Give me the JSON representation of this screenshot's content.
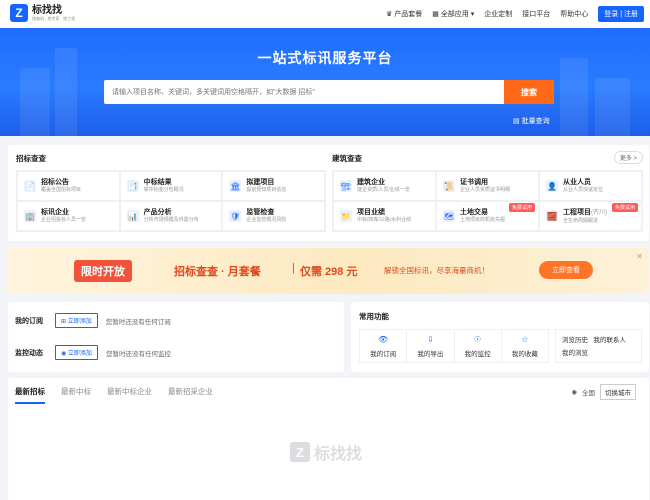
{
  "header": {
    "logo_letter": "Z",
    "logo_name": "标找找",
    "logo_sub": "找商机 · 找专家 · 找工程",
    "nav": {
      "product": "产品套餐",
      "all_apps": "全部应用",
      "enterprise": "企业定制",
      "api": "接口平台",
      "help": "帮助中心",
      "login": "登录 | 注册"
    }
  },
  "hero": {
    "title": "一站式标讯服务平台",
    "search_placeholder": "请输入项目名称、关键词，多关键词用空格隔开，如\"大数据 招标\"",
    "search_button": "搜索",
    "batch_query": "批量查询"
  },
  "bidding": {
    "title": "招标查查",
    "items": [
      {
        "icon": "📄",
        "title": "招标公告",
        "desc": "覆盖全国招标项目"
      },
      {
        "icon": "📑",
        "title": "中标结果",
        "desc": "掌中标金分包概况"
      },
      {
        "icon": "🏛",
        "title": "拟建项目",
        "desc": "提前预知项目信息"
      },
      {
        "icon": "🏢",
        "title": "标讯企业",
        "desc": "企业招投标人员一览"
      },
      {
        "icon": "📊",
        "title": "产品分析",
        "desc": "分析市场规模及供需分布"
      },
      {
        "icon": "🛡",
        "title": "监管检查",
        "desc": "企业监管概况风险"
      }
    ]
  },
  "construction": {
    "title": "建筑查查",
    "more": "更多 >",
    "items": [
      {
        "icon": "🏗",
        "title": "建筑企业",
        "desc": "建企资质/人员/业绩一览",
        "tag": ""
      },
      {
        "icon": "📜",
        "title": "证书调用",
        "desc": "企业人员资质证书明细",
        "tag": ""
      },
      {
        "icon": "👤",
        "title": "从业人员",
        "desc": "从业人员快速定位",
        "tag": ""
      },
      {
        "icon": "📁",
        "title": "项目业绩",
        "desc": "中标/四库/公路/水利业绩",
        "tag": ""
      },
      {
        "icon": "🗺",
        "title": "土地交易",
        "desc": "土地项目商机抢先掘",
        "tag": "免费试用"
      },
      {
        "icon": "🧱",
        "title": "工程项目",
        "desc": "全生命周期跟进",
        "tag": "免费试用",
        "extra": "(齐川)"
      }
    ]
  },
  "banner": {
    "badge": "限时开放",
    "main": "招标查查 · 月套餐",
    "sep": "|",
    "price": "仅需 298 元",
    "desc": "解锁全国标讯，尽享海量商机！",
    "button": "立即查看",
    "close": "✕"
  },
  "subscriptions": {
    "rows": [
      {
        "label": "我的订阅",
        "button": "立即添加",
        "message": "您暂时还没有任何订阅"
      },
      {
        "label": "监控动态",
        "button": "立即添加",
        "message": "您暂时还没有任何监控"
      }
    ]
  },
  "functions": {
    "title": "常用功能",
    "items": [
      {
        "icon": "👁",
        "label": "我的订阅"
      },
      {
        "icon": "⇩",
        "label": "我的导出"
      },
      {
        "icon": "☉",
        "label": "我的监控"
      },
      {
        "icon": "☆",
        "label": "我的收藏"
      }
    ],
    "history": "浏览历史",
    "contacts": "我的联系人",
    "viewed": "我的浏览"
  },
  "listing": {
    "tabs": [
      "最新招标",
      "最新中标",
      "最新中标企业",
      "最新招采企业"
    ],
    "region_label": "全国",
    "switch_city": "切换城市"
  },
  "watermark": {
    "letter": "Z",
    "text": "标找找"
  }
}
